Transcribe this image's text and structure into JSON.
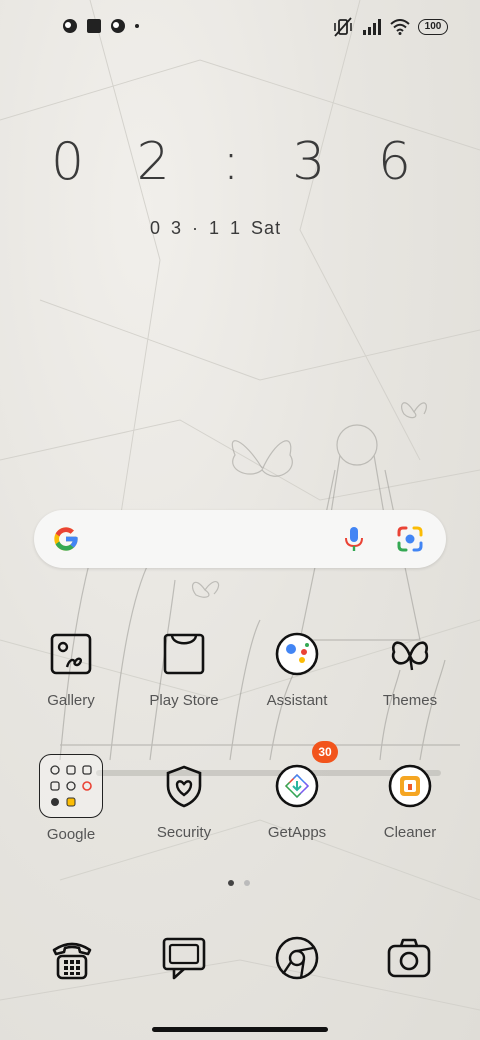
{
  "status_bar": {
    "battery": "100"
  },
  "clock": {
    "time": "0 2 : 3 6"
  },
  "date": {
    "date": "0 3 · 1 1",
    "day": "Sat"
  },
  "search": {
    "mic_icon": "microphone-icon",
    "lens_icon": "google-lens-icon"
  },
  "apps_row1": [
    {
      "label": "Gallery",
      "icon": "gallery-icon"
    },
    {
      "label": "Play Store",
      "icon": "play-store-icon"
    },
    {
      "label": "Assistant",
      "icon": "assistant-icon"
    },
    {
      "label": "Themes",
      "icon": "themes-icon"
    }
  ],
  "apps_row2": [
    {
      "label": "Google",
      "icon": "google-folder-icon"
    },
    {
      "label": "Security",
      "icon": "security-icon"
    },
    {
      "label": "GetApps",
      "icon": "getapps-icon",
      "badge": "30"
    },
    {
      "label": "Cleaner",
      "icon": "cleaner-icon"
    }
  ],
  "dock": [
    {
      "icon": "phone-icon"
    },
    {
      "icon": "messages-icon"
    },
    {
      "icon": "browser-icon"
    },
    {
      "icon": "camera-icon"
    }
  ],
  "page_indicator": {
    "pages": 2,
    "current": 1
  },
  "colors": {
    "badge": "#f2541c",
    "google_blue": "#4285F4",
    "google_red": "#EA4335",
    "google_yellow": "#FBBC05",
    "google_green": "#34A853"
  }
}
